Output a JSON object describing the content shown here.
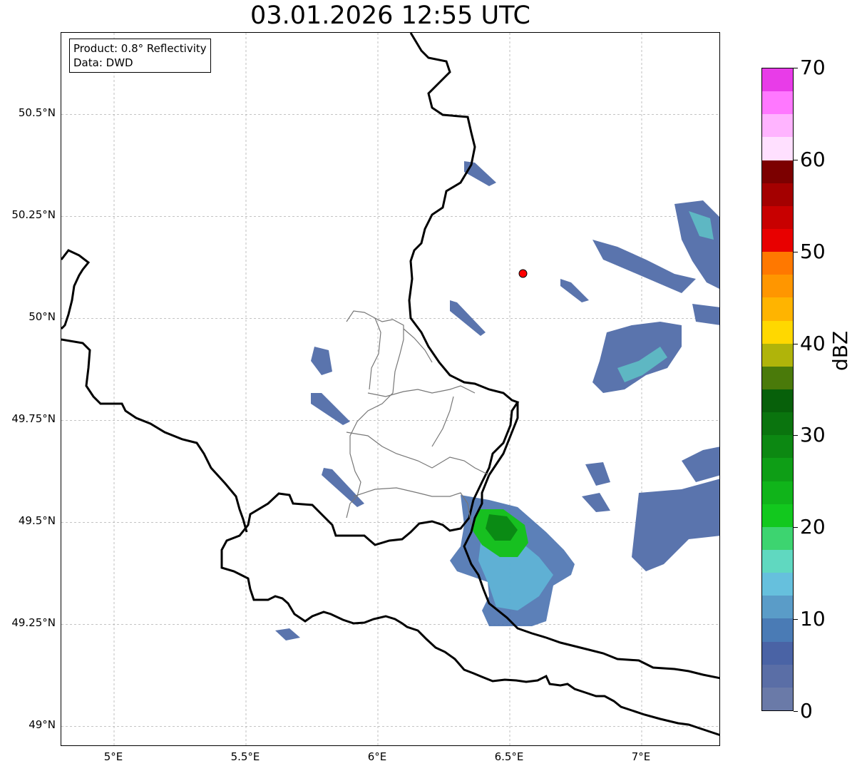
{
  "title": "03.01.2026 12:55 UTC",
  "info": {
    "product": "Product: 0.8° Reflectivity",
    "data": "Data: DWD"
  },
  "map": {
    "lon_range": [
      4.8,
      7.3
    ],
    "lat_range": [
      48.95,
      50.7
    ],
    "lat_ticks": [
      {
        "value": 50.5,
        "label": "50.5°N"
      },
      {
        "value": 50.25,
        "label": "50.25°N"
      },
      {
        "value": 50.0,
        "label": "50°N"
      },
      {
        "value": 49.75,
        "label": "49.75°N"
      },
      {
        "value": 49.5,
        "label": "49.5°N"
      },
      {
        "value": 49.25,
        "label": "49.25°N"
      },
      {
        "value": 49.0,
        "label": "49°N"
      }
    ],
    "lon_ticks": [
      {
        "value": 5.0,
        "label": "5°E"
      },
      {
        "value": 5.5,
        "label": "5.5°E"
      },
      {
        "value": 6.0,
        "label": "6°E"
      },
      {
        "value": 6.5,
        "label": "6.5°E"
      },
      {
        "value": 7.0,
        "label": "7°E"
      }
    ],
    "radar_site": {
      "lon": 6.55,
      "lat": 50.11,
      "color": "#ff0000"
    },
    "grid_color": "#b0b0b0"
  },
  "colorbar": {
    "unit": "dBZ",
    "min": 0,
    "max": 70,
    "tick_labels": [
      "0",
      "10",
      "20",
      "30",
      "40",
      "50",
      "60",
      "70"
    ],
    "colors": [
      "#6a7aa8",
      "#5a6ea6",
      "#4a63a5",
      "#4a7bb5",
      "#5a9cc8",
      "#66c0dd",
      "#60d8c0",
      "#3dd470",
      "#12c81e",
      "#10b41a",
      "#0e9e16",
      "#0c8812",
      "#0a740e",
      "#07600a",
      "#4a7a0a",
      "#b0b40a",
      "#ffd800",
      "#ffb400",
      "#ff9600",
      "#ff7800",
      "#e80000",
      "#c80000",
      "#a40000",
      "#7c0000",
      "#ffe0ff",
      "#ffb4ff",
      "#ff78ff",
      "#e83ce8"
    ]
  }
}
